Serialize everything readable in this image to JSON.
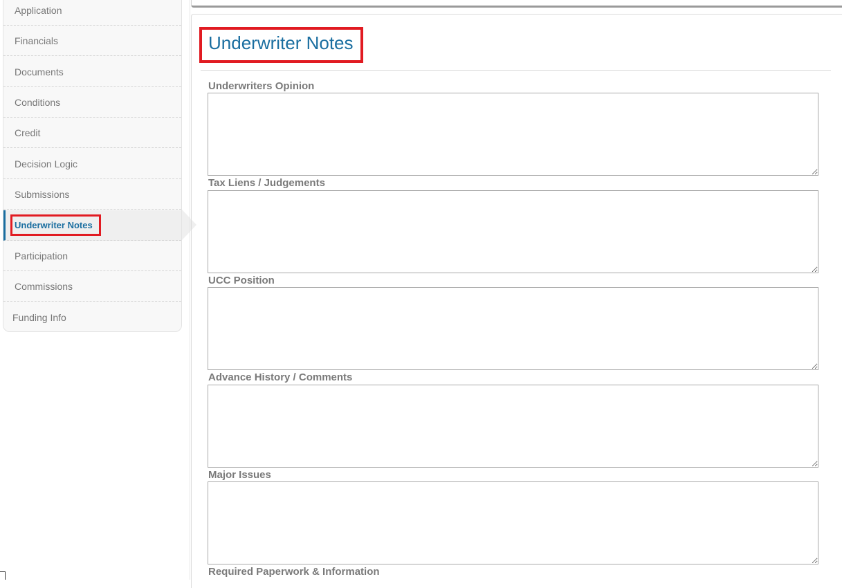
{
  "sidebar": {
    "items": [
      {
        "label": "Application"
      },
      {
        "label": "Financials"
      },
      {
        "label": "Documents"
      },
      {
        "label": "Conditions"
      },
      {
        "label": "Credit"
      },
      {
        "label": "Decision Logic"
      },
      {
        "label": "Submissions"
      },
      {
        "label": "Underwriter Notes",
        "active": true
      },
      {
        "label": "Participation"
      },
      {
        "label": "Commissions"
      },
      {
        "label": "Funding Info"
      }
    ]
  },
  "main": {
    "title": "Underwriter Notes",
    "fields": [
      {
        "label": "Underwriters Opinion",
        "value": ""
      },
      {
        "label": "Tax Liens / Judgements",
        "value": ""
      },
      {
        "label": "UCC Position",
        "value": ""
      },
      {
        "label": "Advance History / Comments",
        "value": ""
      },
      {
        "label": "Major Issues",
        "value": ""
      },
      {
        "label": "Required Paperwork & Information",
        "value": ""
      }
    ]
  },
  "colors": {
    "accent": "#1a6ea0",
    "highlight_border": "#e11b22",
    "label_gray": "#7a7a7a"
  }
}
